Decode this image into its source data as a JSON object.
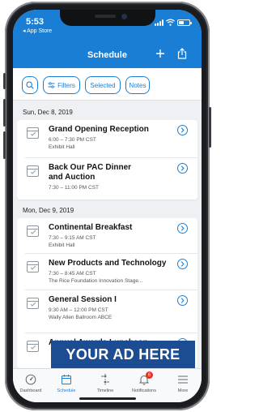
{
  "status_bar": {
    "time": "5:53",
    "back_app": "◂ App Store"
  },
  "header": {
    "title": "Schedule",
    "add_icon": "plus-icon",
    "share_icon": "share-icon"
  },
  "filter_bar": {
    "search_icon": "search-icon",
    "filters_label": "Filters",
    "selected_label": "Selected",
    "notes_label": "Notes"
  },
  "days": [
    {
      "date": "Sun, Dec 8, 2019",
      "sessions": [
        {
          "title": "Grand Opening Reception",
          "time": "6:00 – 7:30 PM CST",
          "location": "Exhibit Hall"
        },
        {
          "title": "Back Our PAC Dinner and Auction",
          "time": "7:30 – 11:00 PM CST",
          "location": ""
        }
      ]
    },
    {
      "date": "Mon, Dec 9, 2019",
      "sessions": [
        {
          "title": "Continental Breakfast",
          "time": "7:30 – 9:15 AM CST",
          "location": "Exhibit Hall"
        },
        {
          "title": "New Products and Technology",
          "time": "7:30 – 8:45 AM CST",
          "location": "The Rice Foundation Innovation Stage..."
        },
        {
          "title": "General Session I",
          "time": "9:30 AM – 12:00 PM CST",
          "location": "Wally Allen Ballroom ABCE"
        },
        {
          "title": "Annual Awards Luncheon",
          "time": "",
          "location": ""
        }
      ]
    }
  ],
  "ad_banner": {
    "text": "YOUR AD HERE",
    "color": "#1c4c92"
  },
  "tabs": [
    {
      "label": "Dashboard",
      "icon": "dashboard-icon"
    },
    {
      "label": "Schedule",
      "icon": "calendar-icon",
      "active": true
    },
    {
      "label": "Timeline",
      "icon": "timeline-icon"
    },
    {
      "label": "Notifications",
      "icon": "bell-icon",
      "badge": "6"
    },
    {
      "label": "More",
      "icon": "menu-icon"
    }
  ],
  "colors": {
    "accent": "#1a7fd4",
    "badge": "#e0332b",
    "background": "#eef0f3"
  }
}
